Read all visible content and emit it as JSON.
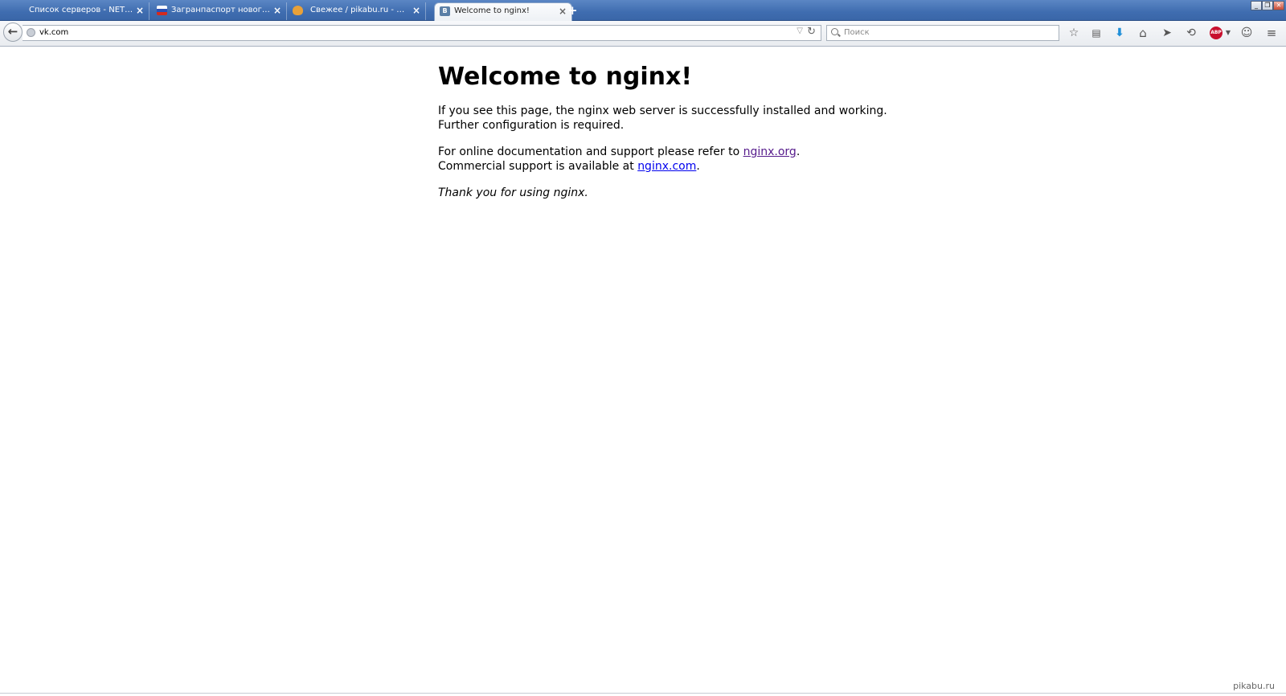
{
  "tabs": [
    {
      "title": "Список серверов - NETWOR...",
      "favicon": "blank",
      "active": false
    },
    {
      "title": "Загранпаспорт нового поко...",
      "favicon": "russian-flag",
      "active": false
    },
    {
      "title": "Свежее / pikabu.ru - Все",
      "favicon": "pikabu",
      "active": false
    },
    {
      "title": "Welcome to nginx!",
      "favicon": "vk",
      "active": true
    }
  ],
  "new_tab_label": "+",
  "window_controls": {
    "minimize": "_",
    "restore": "❐",
    "close": "✕"
  },
  "navbar": {
    "back_symbol": "←",
    "url": "vk.com",
    "search_placeholder": "Поиск"
  },
  "toolbar_icons": [
    "bookmark-star-icon",
    "reading-list-icon",
    "downloads-icon",
    "home-icon",
    "send-icon",
    "history-icon",
    "adblock-icon",
    "chat-icon",
    "menu-icon"
  ],
  "adblock_label": "ABP",
  "page": {
    "heading": "Welcome to nginx!",
    "para1_line1": "If you see this page, the nginx web server is successfully installed and working.",
    "para1_line2": "Further configuration is required.",
    "para2_prefix": "For online documentation and support please refer to ",
    "link_org": "nginx.org",
    "para2_suffix": ".",
    "para3_prefix": "Commercial support is available at ",
    "link_com": "nginx.com",
    "para3_suffix": ".",
    "thanks": "Thank you for using nginx."
  },
  "watermark": "pikabu.ru",
  "colors": {
    "tab_strip": "#3f6db0",
    "visited_link": "#551a8b",
    "link": "#0000ee",
    "adblock": "#c8102e"
  }
}
